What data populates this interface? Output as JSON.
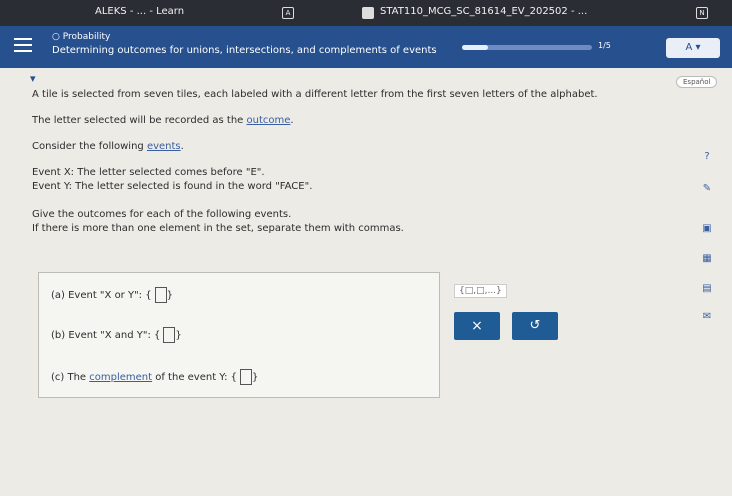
{
  "browser": {
    "tab_left": "ALEKS - ... - Learn",
    "tab_left_badge": "A",
    "tab_right": "STAT110_MCG_SC_81614_EV_202502 - ...",
    "tab_right_badge": "N"
  },
  "header": {
    "topic": "Probability",
    "title": "Determining outcomes for unions, intersections, and complements of events",
    "progress_count": "1/5",
    "progress_fraction": 0.2,
    "accessibility_button": "A",
    "espanol": "Español"
  },
  "problem": {
    "intro": "A tile is selected from seven tiles, each labeled with a different letter from the first seven letters of the alphabet.",
    "outcome_text_pre": "The letter selected will be recorded as the ",
    "outcome_link": "outcome",
    "outcome_text_post": ".",
    "consider_pre": "Consider the following ",
    "events_link": "events",
    "consider_post": ".",
    "event_x": "Event X: The letter selected comes before \"E\".",
    "event_y": "Event Y: The letter selected is found in the word \"FACE\".",
    "instruction1": "Give the outcomes for each of the following events.",
    "instruction2_pre": "If there is more than one element in the set, separate them with commas.",
    "set_link": "set"
  },
  "questions": {
    "a_label": "(a) Event \"X or Y\":",
    "b_label": "(b) Event \"X and Y\":",
    "c_label_pre": "(c) The ",
    "c_link": "complement",
    "c_label_post": " of the event Y:"
  },
  "tools": {
    "keypad_label": "{□,□,...}",
    "clear": "×",
    "undo": "↺"
  },
  "side_icons": [
    "?",
    "✎",
    "▣",
    "▦",
    "▤",
    "✉"
  ]
}
